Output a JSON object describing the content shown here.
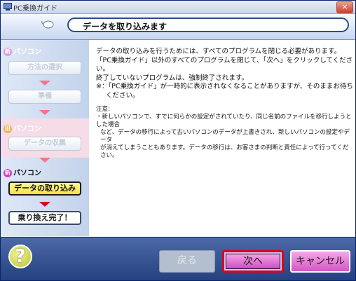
{
  "window": {
    "title": "PC乗換ガイド",
    "close_label": "×"
  },
  "header": {
    "title": "データを取り込みます"
  },
  "steps": {
    "new_pc_label": "パソコン",
    "new_badge": "新",
    "old_pc_label": "パソコン",
    "old_badge": "旧",
    "new_pc2_label": "パソコン",
    "new2_badge": "新",
    "items": [
      {
        "label": "方法の選択",
        "state": "done"
      },
      {
        "label": "準備",
        "state": "done"
      },
      {
        "label": "データの収集",
        "state": "done"
      },
      {
        "label": "データの取り込み",
        "state": "active"
      },
      {
        "label": "乗り換え完了！",
        "state": "next"
      }
    ]
  },
  "content": {
    "line1": "データの取り込みを行うためには、すべてのプログラムを閉じる必要があります。",
    "line2": "「PC乗換ガイド」以外のすべてのプログラムを閉じて、「次へ」をクリックしてください。",
    "line3": "終了していないプログラムは、強制終了されます。",
    "line4": "※：「PC乗換ガイド」が一時的に表示されなくなることがありますが、そのままお待ち",
    "line5": "ください。",
    "note_title": "注意:",
    "note1": "・新しいパソコンで、すでに何らかの設定がされていたり、同じ名前のファイルを移行しようとした場合",
    "note2": "など、データの移行によって古いパソコンのデータが上書きされ、新しいパソコンの設定やデータ",
    "note3": "が消えてしまうこともあります。データの移行は、お客さまの判断と責任によって行ってください。"
  },
  "footer": {
    "help_label": "?",
    "back_label": "戻る",
    "next_label": "次へ",
    "cancel_label": "キャンセル"
  },
  "colors": {
    "accent_highlight": "#e0001b",
    "active_step": "#f6e23a",
    "arrow": "#f2768a",
    "bottom_bar": "#24407e"
  }
}
